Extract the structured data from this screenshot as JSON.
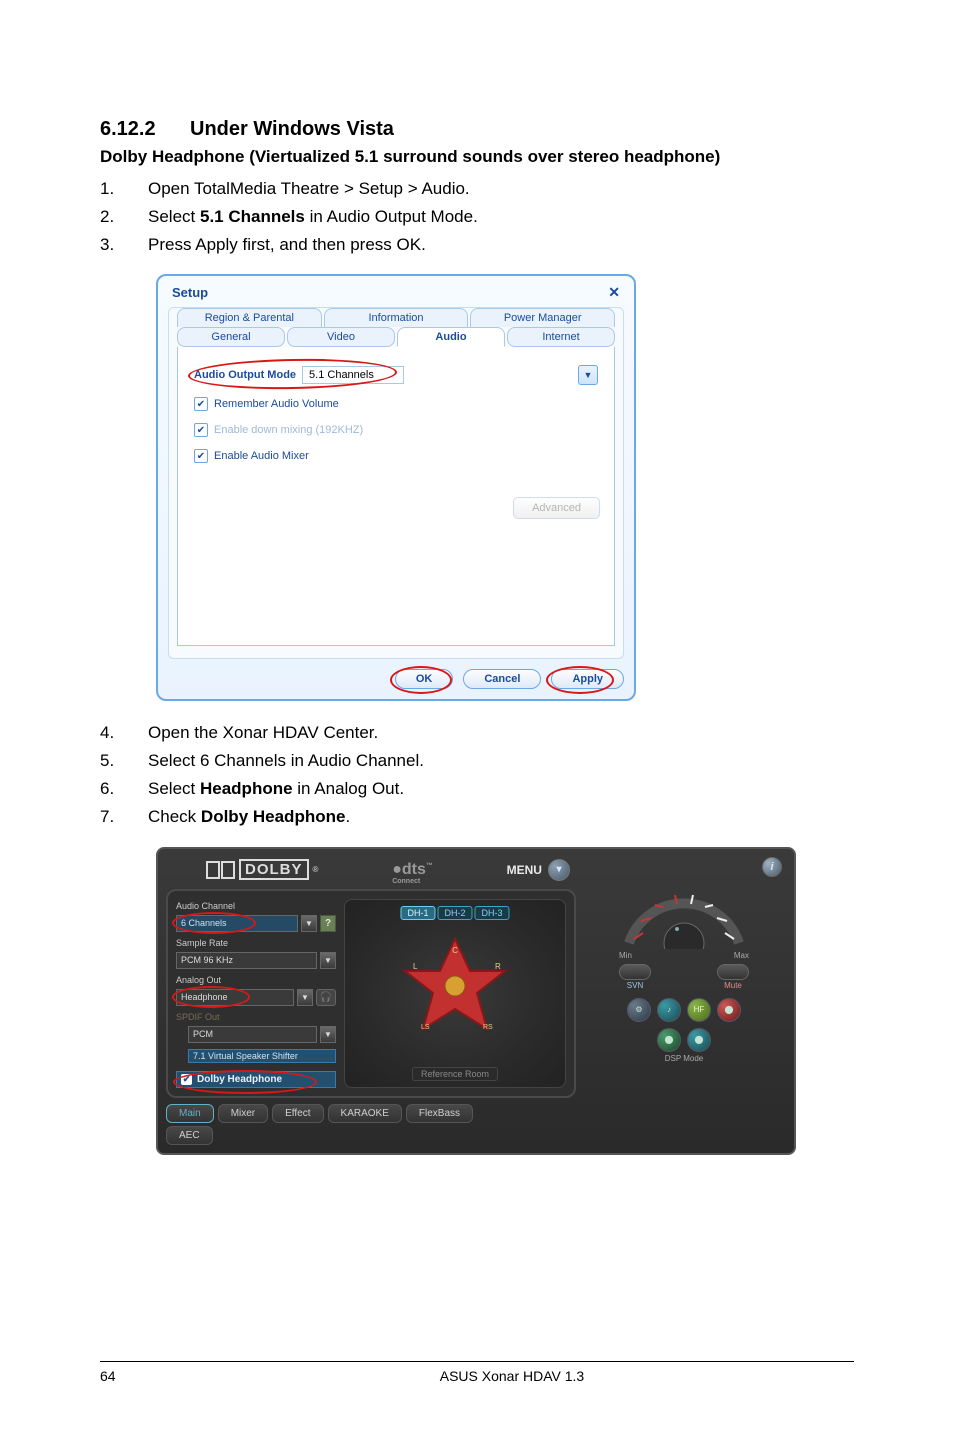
{
  "section": {
    "number": "6.12.2",
    "title": "Under Windows Vista"
  },
  "subhead": "Dolby Headphone (Viertualized 5.1 surround sounds over stereo headphone)",
  "steps_a": [
    {
      "n": "1.",
      "t_pre": "Open TotalMedia Theatre > Setup > Audio."
    },
    {
      "n": "2.",
      "t_pre": "Select ",
      "bold": "5.1 Channels",
      "t_post": " in Audio Output Mode."
    },
    {
      "n": "3.",
      "t_pre": "Press Apply first, and then press OK."
    }
  ],
  "steps_b": [
    {
      "n": "4.",
      "t_pre": "Open the Xonar HDAV Center."
    },
    {
      "n": "5.",
      "t_pre": "Select 6 Channels in Audio Channel."
    },
    {
      "n": "6.",
      "t_pre": "Select ",
      "bold": "Headphone",
      "t_post": " in Analog Out."
    },
    {
      "n": "7.",
      "t_pre": "Check ",
      "bold": "Dolby Headphone",
      "t_post": "."
    }
  ],
  "setup": {
    "title": "Setup",
    "tabs_row1": [
      "Region & Parental",
      "Information",
      "Power Manager"
    ],
    "tabs_row2": [
      "General",
      "Video",
      "Audio",
      "Internet"
    ],
    "aom_label": "Audio Output Mode",
    "aom_value": "5.1 Channels",
    "chk1": "Remember Audio Volume",
    "chk2": "Enable down mixing (192KHZ)",
    "chk3": "Enable Audio Mixer",
    "advanced": "Advanced",
    "ok": "OK",
    "cancel": "Cancel",
    "apply": "Apply"
  },
  "xonar": {
    "dolby": "DOLBY",
    "dts": "dts",
    "dts_sub": "Connect",
    "menu": "MENU",
    "groups": {
      "audio_channel": "Audio Channel",
      "audio_channel_val": "6 Channels",
      "sample_rate": "Sample Rate",
      "sample_rate_val": "PCM 96 KHz",
      "analog_out": "Analog Out",
      "analog_out_val": "Headphone",
      "spdif_out": "SPDIF Out",
      "spdif_out_val": "PCM",
      "shifter": "7.1 Virtual Speaker Shifter",
      "dolby_hp": "Dolby Headphone"
    },
    "dh_tabs": [
      "DH-1",
      "DH-2",
      "DH-3"
    ],
    "reference_room": "Reference Room",
    "bottom_tabs": [
      "Main",
      "Mixer",
      "Effect",
      "KARAOKE",
      "FlexBass"
    ],
    "aec": "AEC",
    "gauge": {
      "min": "Min",
      "max": "Max",
      "svn": "SVN",
      "mute": "Mute"
    },
    "mode_dots": [
      "",
      "",
      "HF",
      "",
      "",
      ""
    ],
    "dsp": "DSP Mode"
  },
  "footer": {
    "page": "64",
    "title": "ASUS Xonar HDAV 1.3"
  }
}
